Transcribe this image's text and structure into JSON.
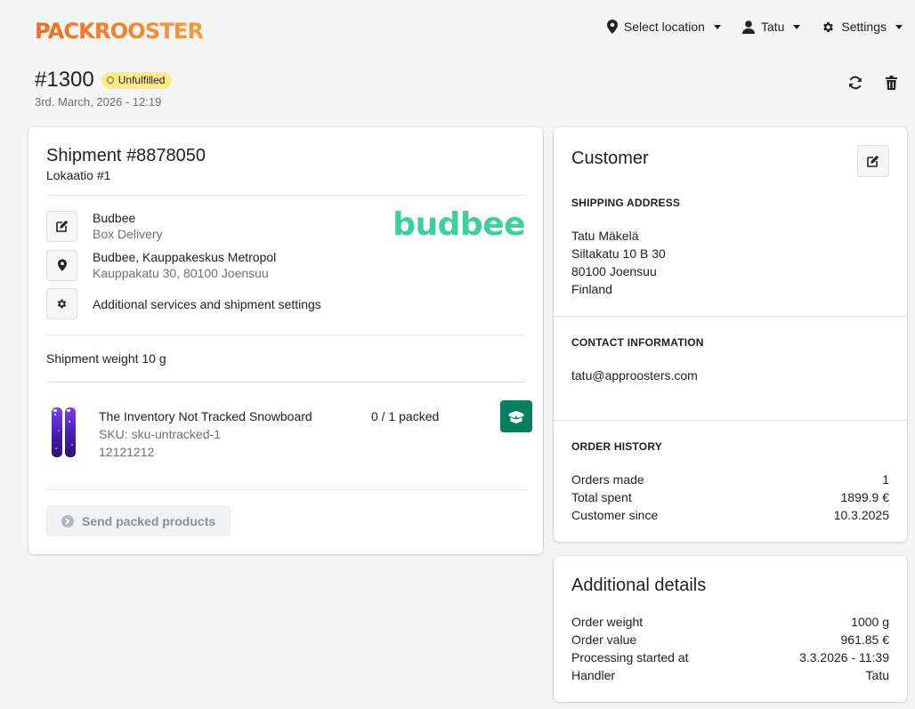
{
  "brand": {
    "name": "PACKROOSTER",
    "primary_color": "#f26b21",
    "accent_color": "#f5a623"
  },
  "topnav": {
    "location": {
      "label": "Select location",
      "icon": "location-pin-icon"
    },
    "user": {
      "label": "Tatu",
      "icon": "user-icon"
    },
    "settings": {
      "label": "Settings",
      "icon": "gear-icon"
    }
  },
  "order": {
    "number": "#1300",
    "status": "Unfulfilled",
    "date": "3rd. March, 2026 - 12:19",
    "actions": {
      "refresh_icon": "refresh-icon",
      "delete_icon": "trash-icon"
    }
  },
  "shipment": {
    "title": "Shipment",
    "id": "#8878050",
    "location": "Lokaatio #1",
    "carrier": {
      "name": "Budbee",
      "service": "Box Delivery",
      "logo_text": "budbee",
      "logo_color": "#3ecf9b"
    },
    "pickup": {
      "name": "Budbee, Kauppakeskus Metropol",
      "address": "Kauppakatu 30, 80100 Joensuu"
    },
    "services_label": "Additional services and shipment settings",
    "weight_label": "Shipment weight 10 g",
    "products": [
      {
        "name": "The Inventory Not Tracked Snowboard",
        "sku": "SKU: sku-untracked-1",
        "barcode": "12121212",
        "packed": "0 / 1 packed"
      }
    ],
    "send_label": "Send packed products"
  },
  "customer": {
    "title": "Customer",
    "shipping_label": "SHIPPING ADDRESS",
    "address": [
      "Tatu Mäkelä",
      "Siltakatu 10 B 30",
      "80100 Joensuu",
      "Finland"
    ],
    "contact_label": "CONTACT INFORMATION",
    "email": "tatu@approosters.com",
    "history_label": "ORDER HISTORY",
    "history": [
      {
        "label": "Orders made",
        "value": "1"
      },
      {
        "label": "Total spent",
        "value": "1899.9 €"
      },
      {
        "label": "Customer since",
        "value": "10.3.2025"
      }
    ]
  },
  "details": {
    "title": "Additional details",
    "rows": [
      {
        "label": "Order weight",
        "value": "1000 g"
      },
      {
        "label": "Order value",
        "value": "961.85 €"
      },
      {
        "label": "Processing started at",
        "value": "3.3.2026 - 11:39"
      },
      {
        "label": "Handler",
        "value": "Tatu"
      }
    ]
  },
  "colors": {
    "pack_button": "#008060",
    "badge_bg": "#ffea8a"
  }
}
